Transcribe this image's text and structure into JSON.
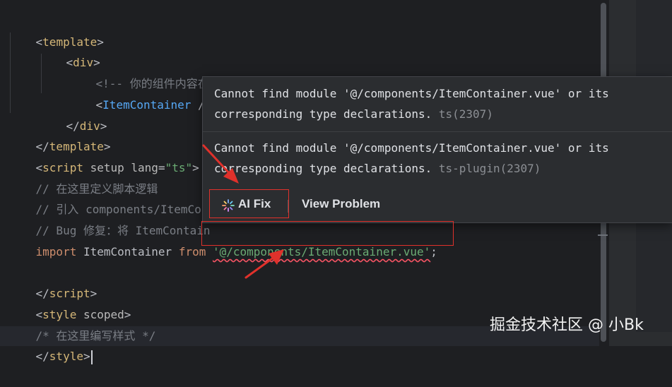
{
  "code_lines": [
    {
      "open": "<",
      "tag": "template",
      "close": ">"
    },
    {
      "open": "<",
      "tag": "div",
      "close": ">"
    },
    {
      "comment": "<!-- 你的组件内容在这里 -->"
    },
    {
      "open": "<",
      "comp": "ItemContainer",
      "close": " />"
    },
    {
      "open": "</",
      "tag": "div",
      "close": ">"
    },
    {
      "open": "</",
      "tag": "template",
      "close": ">"
    },
    {
      "open": "<",
      "tag": "script",
      "attr1": " setup",
      "attr2": " lang",
      "eq": "=",
      "val": "\"ts\"",
      "close": ">"
    },
    {
      "comment": "// 在这里定义脚本逻辑"
    },
    {
      "comment": "// 引入 components/ItemCont"
    },
    {
      "comment": "// Bug 修复：将 ItemContain"
    },
    {
      "kw": "import",
      "ident": " ItemContainer ",
      "kw2": "from",
      "space": " ",
      "str": "'@/components/ItemContainer.vue'",
      "semi": ";"
    },
    {
      "open": "</",
      "tag": "script",
      "close": ">"
    },
    {
      "open": "<",
      "tag": "style",
      "attr1": " scoped",
      "close": ">"
    },
    {
      "comment": "/* 在这里编写样式 */"
    },
    {
      "open": "</",
      "tag": "style",
      "close": ">"
    }
  ],
  "popup": {
    "problem1_text": "Cannot find module '@/components/ItemContainer.vue' or its\ncorresponding type declarations.",
    "problem1_code": " ts(2307)",
    "problem2_text": "Cannot find module '@/components/ItemContainer.vue' or its\ncorresponding type declarations.",
    "problem2_code": " ts-plugin(2307)",
    "ai_fix_label": "AI Fix",
    "view_problem_label": "View Problem"
  },
  "colors": {
    "background": "#1e1f22",
    "popup_bg": "#2b2d30",
    "tag": "#d5b778",
    "keyword": "#cf8e6d",
    "string": "#6aab73",
    "component": "#56a8f5",
    "comment": "#7a7e85",
    "error_squiggle": "#f75464",
    "annotation_red": "#e0312b"
  },
  "icons": {
    "ai_fix": "sparkle-icon"
  },
  "watermark": "掘金技术社区 @ 小Bk"
}
